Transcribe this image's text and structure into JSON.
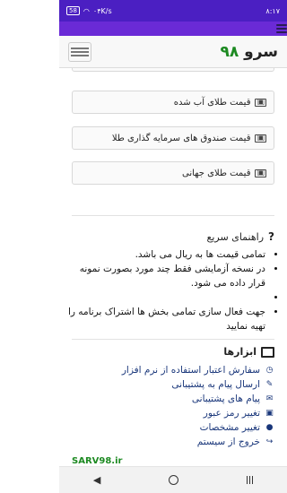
{
  "status_bar": {
    "time": "۸:۱۷",
    "network": "۰۴K/s",
    "battery": "58"
  },
  "header": {
    "brand_word": "سرو",
    "brand_number": "۹۸"
  },
  "price_cards": [
    {
      "label": "قیمت طلای آب شده"
    },
    {
      "label": "قیمت صندوق های سرمایه گذاری طلا"
    },
    {
      "label": "قیمت طلای جهانی"
    }
  ],
  "guide": {
    "title": "راهنمای سریع",
    "items": [
      "تمامی قیمت ها به ریال می باشد.",
      "در نسخه آزمایشی فقط چند مورد بصورت نمونه قرار داده می شود.",
      "",
      "جهت فعال سازی تمامی بخش ها اشتراک برنامه را تهیه نمایید"
    ]
  },
  "tools": {
    "title": "ابزارها",
    "items": [
      {
        "label": "سفارش اعتبار استفاده از نرم افزار",
        "icon": "clock-icon"
      },
      {
        "label": "ارسال پیام به پشتیبانی",
        "icon": "edit-icon"
      },
      {
        "label": "پیام های پشتیبانی",
        "icon": "envelope-icon"
      },
      {
        "label": "تغییر رمز عبور",
        "icon": "lock-icon"
      },
      {
        "label": "تغییر مشخصات",
        "icon": "user-icon"
      },
      {
        "label": "خروج از سیستم",
        "icon": "logout-icon"
      }
    ]
  },
  "bottom": {
    "watermark": "SARV98.ir"
  }
}
